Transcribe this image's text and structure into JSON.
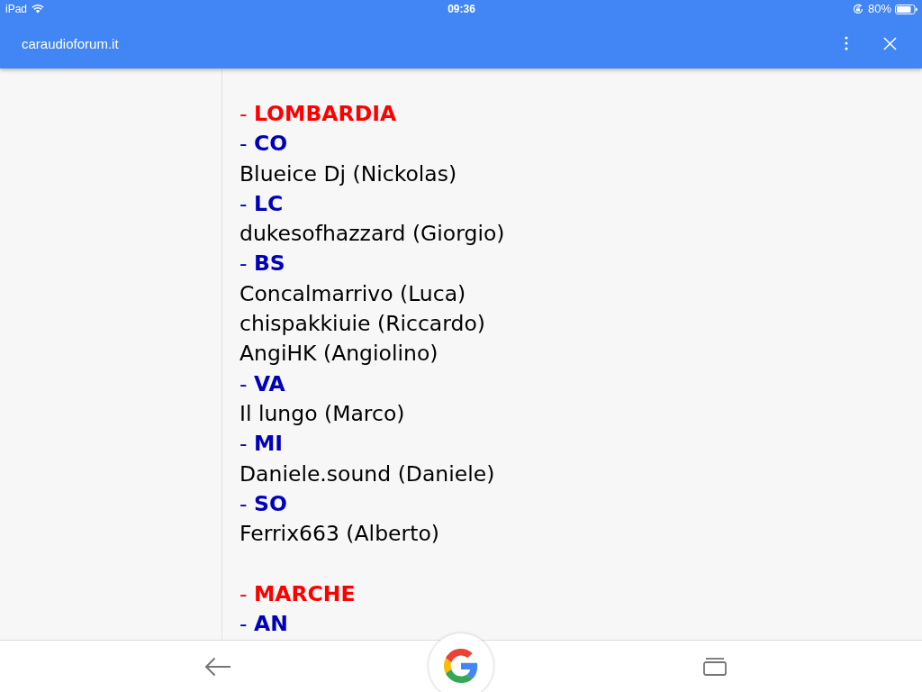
{
  "status_bar": {
    "device": "iPad",
    "time": "09:36",
    "battery": "80%"
  },
  "toolbar": {
    "title": "caraudioforum.it"
  },
  "content": {
    "regions": [
      {
        "heading": "- **LOMBARDIA**",
        "provinces": [
          {
            "heading": "- **CO**",
            "members": [
              "Blueice Dj (Nickolas)"
            ]
          },
          {
            "heading": "- **LC**",
            "members": [
              "dukesofhazzard (Giorgio)"
            ]
          },
          {
            "heading": "- **BS**",
            "members": [
              "Concalmarrivo (Luca)",
              "chispakkiuie (Riccardo)",
              "AngiHK (Angiolino)"
            ]
          },
          {
            "heading": "- **VA**",
            "members": [
              "Il lungo (Marco)"
            ]
          },
          {
            "heading": "- **MI**",
            "members": [
              "Daniele.sound (Daniele)"
            ]
          },
          {
            "heading": "- **SO**",
            "members": [
              "Ferrix663 (Alberto)"
            ]
          }
        ]
      },
      {
        "heading": "- **MARCHE**",
        "provinces": [
          {
            "heading": "- **AN**"
          }
        ]
      }
    ]
  }
}
